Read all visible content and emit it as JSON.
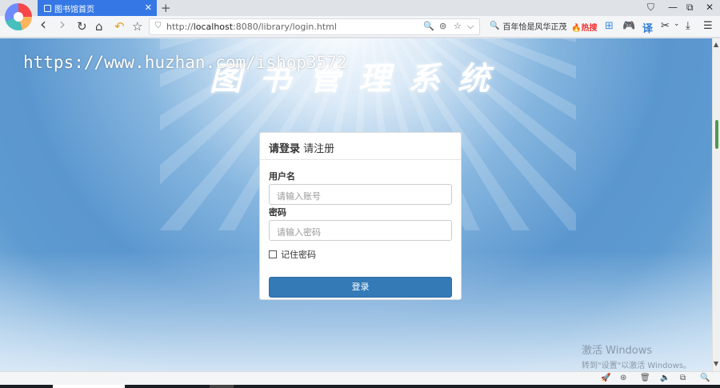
{
  "browser": {
    "tab": {
      "title": "图书馆首页",
      "close": "✕"
    },
    "new_tab": "+",
    "window_controls": {
      "pin": "⛉",
      "minimize": "—",
      "restore": "⧉",
      "close": "✕"
    },
    "nav": {
      "back": "‹",
      "forward": "›",
      "reload": "↻",
      "home": "⌂",
      "undo": "↶",
      "favorite": "☆"
    },
    "address": {
      "prefix": "http://",
      "host": "localhost",
      "rest": ":8080/library/login.html"
    },
    "address_icons": {
      "zoom": "🔍",
      "reader": "⊜",
      "star": "☆",
      "dropdown": "⌵"
    },
    "search": {
      "icon": "🔍",
      "text": "百年恰是风华正茂"
    },
    "hot": "🔥热搜",
    "toolbar_icons": {
      "apps": "⊞",
      "game": "🎮",
      "translate": "译",
      "cut": "✂",
      "cut_dropdown": "⌄",
      "download": "⤓",
      "menu": "☰"
    }
  },
  "page": {
    "title": "图书管理系统",
    "watermark": "https://www.huzhan.com/ishop3572",
    "login": {
      "active_tab": "请登录",
      "register_tab": "请注册",
      "username_label": "用户名",
      "username_placeholder": "请输入账号",
      "password_label": "密码",
      "password_placeholder": "请输入密码",
      "remember_label": "记住密码",
      "submit_label": "登录"
    },
    "activation": {
      "line1": "激活 Windows",
      "line2": "转到\"设置\"以激活 Windows。"
    }
  },
  "scrollbar": {
    "up": "▲",
    "down": "▼"
  },
  "statusbar": {
    "icons": [
      "🚀",
      "⊛",
      "🗑",
      "🔈",
      "⧉",
      "🔍"
    ]
  },
  "colors": {
    "tab_active": "#3578e5",
    "button_primary": "#337ab7",
    "scroll_thumb": "#4d9a4d"
  }
}
